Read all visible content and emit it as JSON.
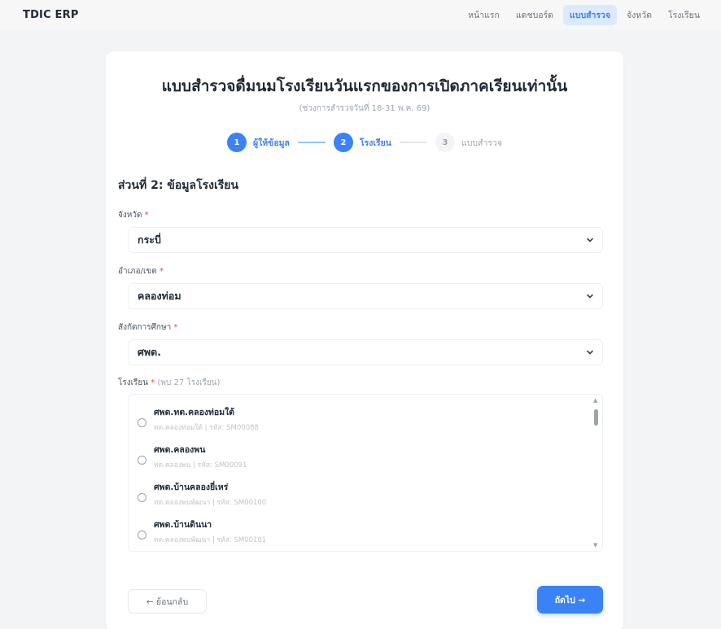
{
  "navbar": {
    "brand": "TDIC ERP",
    "links": [
      {
        "label": "หน้าแรก"
      },
      {
        "label": "แดชบอร์ด"
      },
      {
        "label": "แบบสำรวจ",
        "active": true
      },
      {
        "label": "จังหวัด"
      },
      {
        "label": "โรงเรียน"
      }
    ]
  },
  "form": {
    "title": "แบบสำรวจดื่มนมโรงเรียนวันแรกของการเปิดภาคเรียนเท่านั้น",
    "subtitle": "(ช่วงการสำรวจวันที่ 18-31 พ.ค. 69)",
    "steps": [
      {
        "number": "1",
        "label": "ผู้ให้ข้อมูล",
        "state": "done"
      },
      {
        "number": "2",
        "label": "โรงเรียน",
        "state": "current"
      },
      {
        "number": "3",
        "label": "แบบสำรวจ",
        "state": "pending"
      }
    ],
    "section_title": "ส่วนที่ 2: ข้อมูลโรงเรียน",
    "province": {
      "label": "จังหวัด",
      "required": "*",
      "value": "กระบี่"
    },
    "district": {
      "label": "อำเภอ/เขต",
      "required": "*",
      "value": "คลองท่อม"
    },
    "affiliation": {
      "label": "สังกัดการศึกษา",
      "required": "*",
      "value": "ศพด."
    },
    "school": {
      "label": "โรงเรียน",
      "required": "*",
      "count_hint": "(พบ 27 โรงเรียน)",
      "items": [
        {
          "name": "ศพด.ทต.คลองท่อมใต้",
          "meta": "ทต.คลองท่อมใต้ | รหัส: SM00088"
        },
        {
          "name": "ศพด.คลองพน",
          "meta": "ทต.คลองพน | รหัส: SM00091"
        },
        {
          "name": "ศพด.บ้านคลองยี่เหร่",
          "meta": "ทต.คลองพนพัฒนา | รหัส: SM00100"
        },
        {
          "name": "ศพด.บ้านดินนา",
          "meta": "ทต.คลองพนพัฒนา | รหัส: SM00101"
        }
      ]
    },
    "back_label": "← ย้อนกลับ",
    "next_label": "ถัดไป →"
  },
  "colors": {
    "accent": "#3b82f6",
    "accent_light": "#dbeafe",
    "required": "#ef4444",
    "page_bg": "#f3f4f6"
  },
  "icons": {
    "select_arrow": "chevron-down-icon",
    "scroll_up": "triangle-up-icon",
    "scroll_down": "triangle-down-icon"
  }
}
